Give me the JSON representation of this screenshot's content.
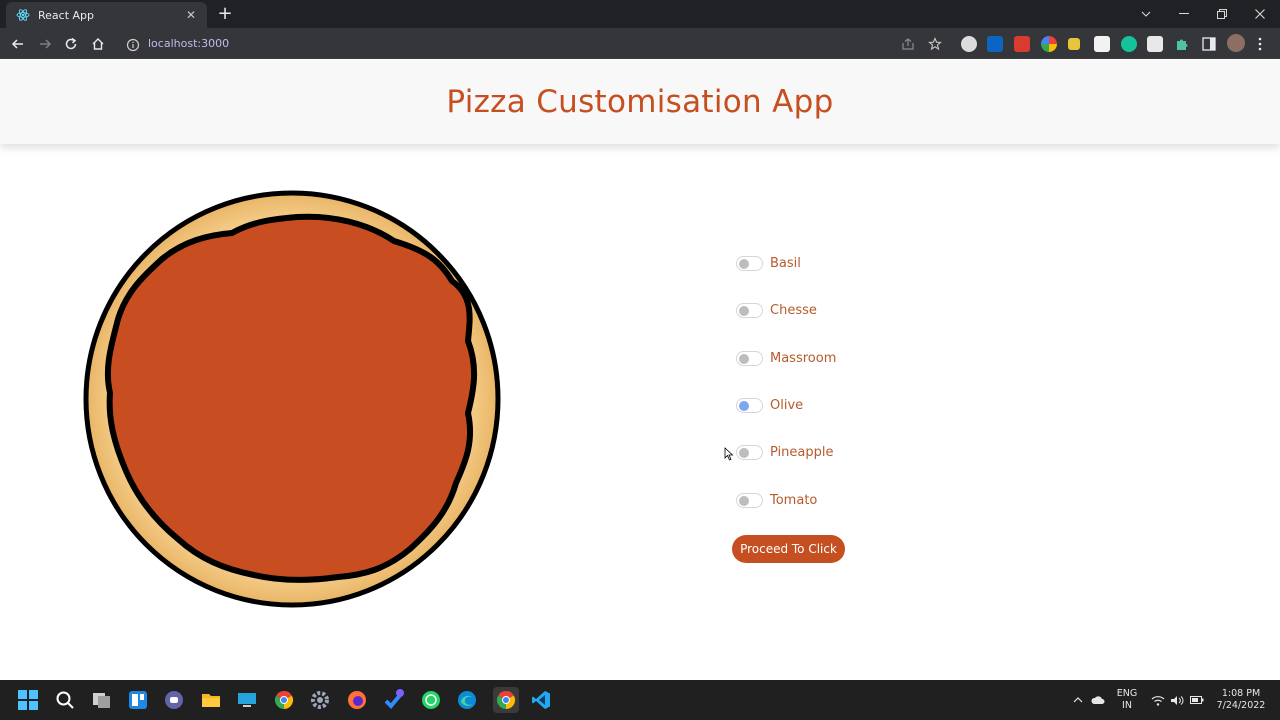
{
  "browser": {
    "tab_title": "React App",
    "tab_close": "✕",
    "new_tab": "+",
    "url": "localhost:3000"
  },
  "app": {
    "title": "Pizza Customisation App",
    "toppings": [
      {
        "label": "Basil",
        "checked": false
      },
      {
        "label": "Chesse",
        "checked": false
      },
      {
        "label": "Massroom",
        "checked": false
      },
      {
        "label": "Olive",
        "checked": true
      },
      {
        "label": "Pineapple",
        "checked": false
      },
      {
        "label": "Tomato",
        "checked": false
      }
    ],
    "proceed_label": "Proceed To Click"
  },
  "taskbar": {
    "language_line1": "ENG",
    "language_line2": "IN",
    "time": "1:08 PM",
    "date": "7/24/2022"
  },
  "colors": {
    "accent": "#c64f21",
    "sauce": "#c84e21",
    "crust": "#f1c47c",
    "toggle_on": "#7ea6f2"
  }
}
